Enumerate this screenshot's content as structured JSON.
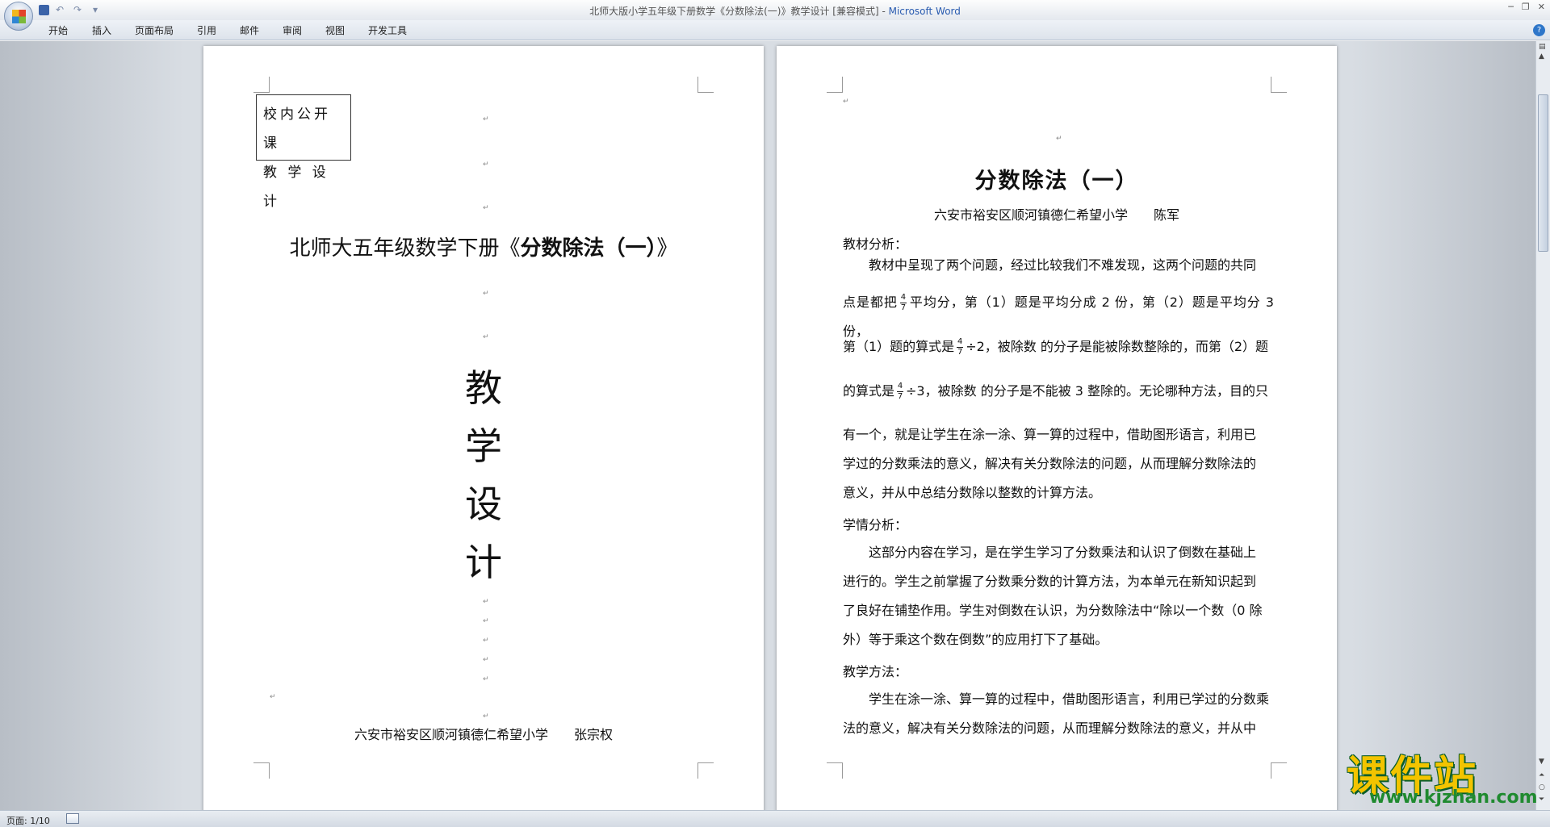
{
  "window": {
    "title_doc": "北师大版小学五年级下册数学《分数除法(一)》教学设计 [兼容模式] - ",
    "title_app": "Microsoft Word"
  },
  "ribbon": {
    "tabs": [
      "开始",
      "插入",
      "页面布局",
      "引用",
      "邮件",
      "审阅",
      "视图",
      "开发工具"
    ]
  },
  "left_page": {
    "stamp_line1": "校内公开课",
    "stamp_line2": "教 学 设 计",
    "title_prefix": "北师大五年级数学下册《",
    "title_bold": "分数除法（一）",
    "title_suffix": "》",
    "big_chars": [
      "教",
      "学",
      "设",
      "计"
    ],
    "school": "六安市裕安区顺河镇德仁希望小学　　张宗权"
  },
  "right_page": {
    "title": "分数除法（一）",
    "author": "六安市裕安区顺河镇德仁希望小学　　陈军",
    "h1": "教材分析：",
    "p1_l1": "　　教材中呈现了两个问题，经过比较我们不难发现，这两个问题的共同",
    "p1_l2a": "点是都把",
    "p1_l2b": "平均分，第（1）题是平均分成 2 份，第（2）题是平均分 3 份，",
    "p1_l3a": "第（1）题的算式是",
    "p1_l3b": "÷2，被除数 的分子是能被除数整除的，而第（2）题",
    "p1_l4a": "的算式是",
    "p1_l4b": "÷3，被除数 的分子是不能被 3 整除的。无论哪种方法，目的只",
    "p1_l5": "有一个，就是让学生在涂一涂、算一算的过程中，借助图形语言，利用已",
    "p1_l6": "学过的分数乘法的意义，解决有关分数除法的问题，从而理解分数除法的",
    "p1_l7": "意义，并从中总结分数除以整数的计算方法。",
    "frac_num": "4",
    "frac_den": "7",
    "h2": "学情分析：",
    "p2_l1": "　　这部分内容在学习，是在学生学习了分数乘法和认识了倒数在基础上",
    "p2_l2": "进行的。学生之前掌握了分数乘分数的计算方法，为本单元在新知识起到",
    "p2_l3": "了良好在铺垫作用。学生对倒数在认识，为分数除法中“除以一个数（0 除",
    "p2_l4": "外）等于乘这个数在倒数”的应用打下了基础。",
    "h3": "教学方法：",
    "p3_l1": "　　学生在涂一涂、算一算的过程中，借助图形语言，利用已学过的分数乘",
    "p3_l2": "法的意义，解决有关分数除法的问题，从而理解分数除法的意义，并从中"
  },
  "statusbar": {
    "page": "页面: 1/10"
  },
  "watermark": {
    "main": "课件站",
    "url": "www.kjzhan.com"
  },
  "colors": {
    "app_title": "#2a5cb0",
    "watermark_yellow": "#f3c400",
    "watermark_green": "#1f8a2f"
  }
}
